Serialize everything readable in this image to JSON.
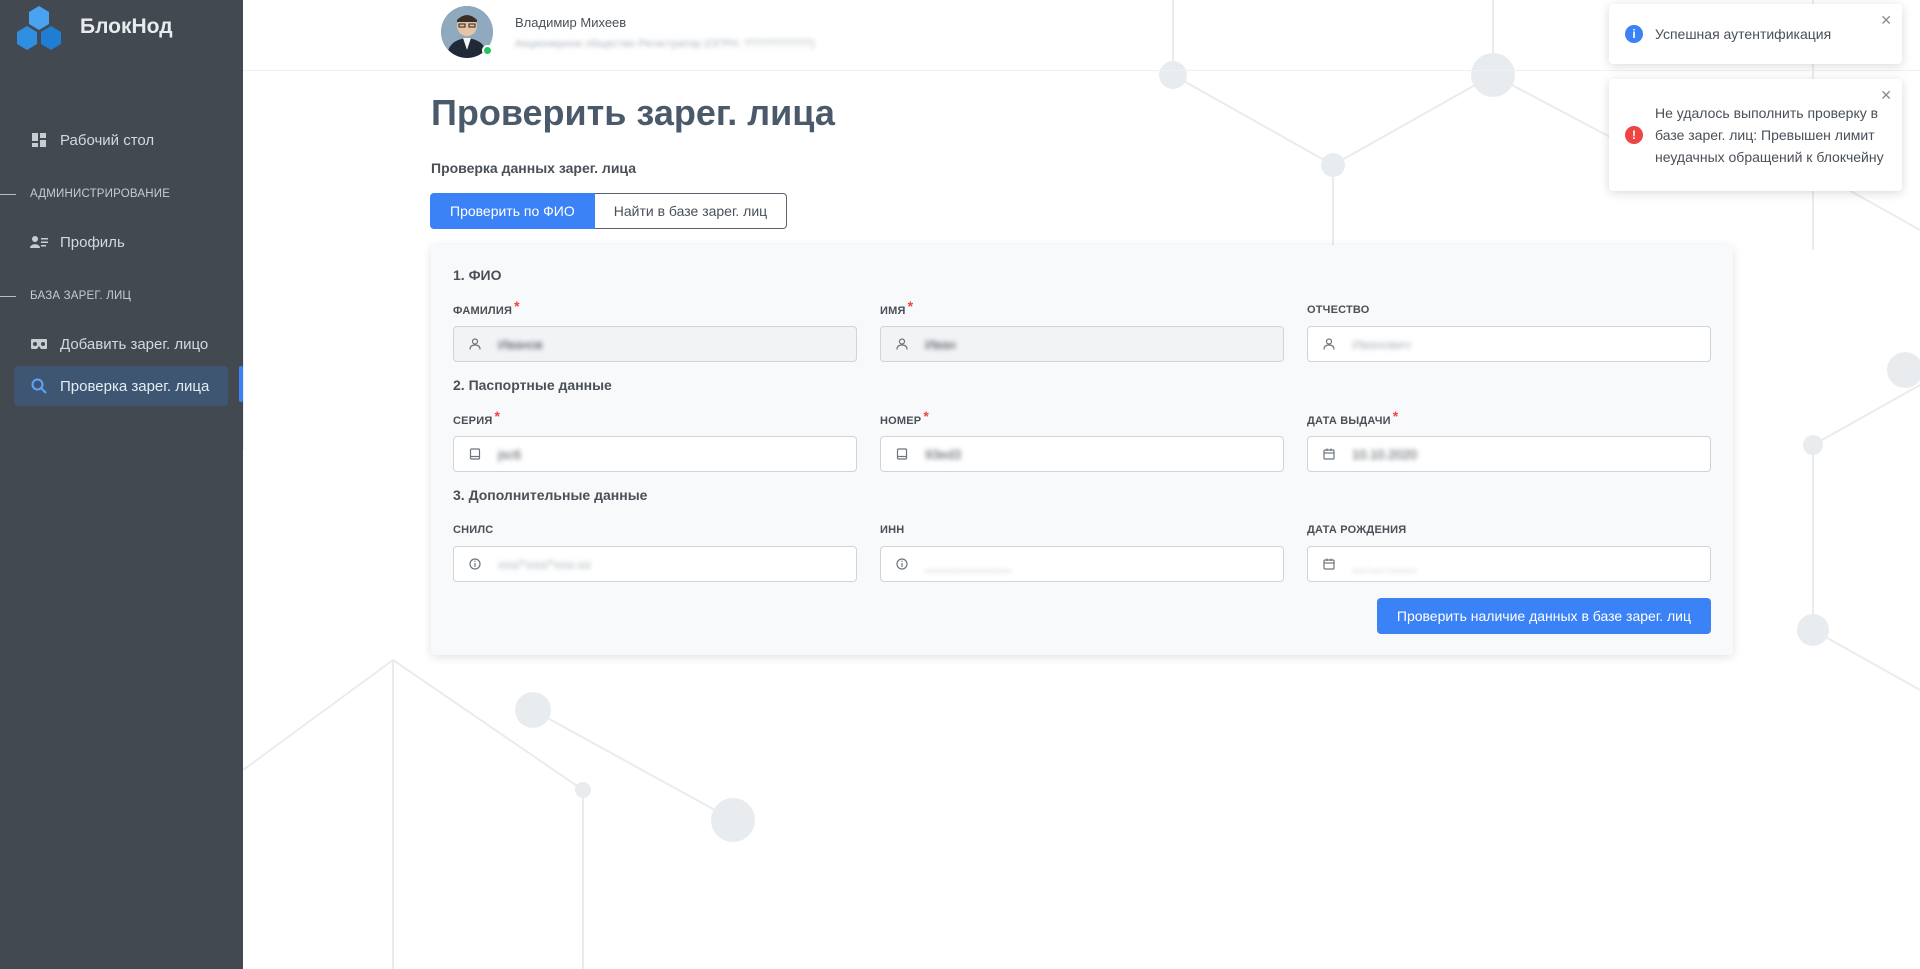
{
  "brand": {
    "name": "БлокНод",
    "logo_icon": "hexagons-logo-icon",
    "color": "#2f8ee0"
  },
  "user": {
    "name": "Владимир Михеев",
    "org": "Акционерное общество Регистратор (ОГРН: ???????????)"
  },
  "sidebar": {
    "items": [
      {
        "label": "Рабочий стол",
        "icon": "dashboard-icon"
      },
      {
        "label": "Профиль",
        "icon": "profile-card-icon"
      },
      {
        "label": "Добавить зарег. лицо",
        "icon": "vr-glasses-icon"
      },
      {
        "label": "Проверка зарег. лица",
        "icon": "search-icon",
        "active": true
      }
    ],
    "sections": [
      "АДМИНИСТРИРОВАНИЕ",
      "БАЗА ЗАРЕГ. ЛИЦ"
    ]
  },
  "page": {
    "title": "Проверить зарег. лица",
    "subtitle": "Проверка данных зарег. лица"
  },
  "tabs": [
    {
      "label": "Проверить по ФИО",
      "active": true
    },
    {
      "label": "Найти в базе зарег. лиц",
      "active": false
    }
  ],
  "form": {
    "sections": [
      "1. ФИО",
      "2. Паспортные данные",
      "3. Дополнительные данные"
    ],
    "fields": {
      "surname": {
        "label": "ФАМИЛИЯ",
        "required": true,
        "value": "Иванов",
        "placeholder": "",
        "icon": "user-icon"
      },
      "name": {
        "label": "ИМЯ",
        "required": true,
        "value": "Иван",
        "placeholder": "",
        "icon": "user-icon"
      },
      "patronymic": {
        "label": "ОТЧЕСТВО",
        "required": false,
        "value": "",
        "placeholder": "Иванович",
        "icon": "user-icon"
      },
      "series": {
        "label": "СЕРИЯ",
        "required": true,
        "value": "jsc6",
        "placeholder": "",
        "icon": "book-icon"
      },
      "number": {
        "label": "НОМЕР",
        "required": true,
        "value": "93ed3",
        "placeholder": "",
        "icon": "book-icon"
      },
      "issue_date": {
        "label": "ДАТА ВЫДАЧИ",
        "required": true,
        "value": "10.10.2020",
        "placeholder": "",
        "icon": "calendar-icon"
      },
      "snils": {
        "label": "СНИЛС",
        "required": false,
        "value": "",
        "placeholder": "xxx/*xxx/*xxx-xx",
        "icon": "info-icon"
      },
      "inn": {
        "label": "ИНН",
        "required": false,
        "value": "",
        "placeholder": "____________",
        "icon": "info-icon"
      },
      "birth_date": {
        "label": "ДАТА РОЖДЕНИЯ",
        "required": false,
        "value": "",
        "placeholder": "__.__.____",
        "icon": "calendar-icon"
      }
    },
    "submit_label": "Проверить наличие данных в базе зарег. лиц"
  },
  "toasts": [
    {
      "type": "info",
      "icon": "info-circle-icon",
      "color": "#3b82f6",
      "text": "Успешная аутентификация"
    },
    {
      "type": "error",
      "icon": "exclamation-circle-icon",
      "color": "#ef4444",
      "text": "Не удалось выполнить проверку в базе зарег. лиц: Превышен лимит неудачных обращений к блокчейну"
    }
  ],
  "colors": {
    "sidebar_bg": "#424950",
    "accent": "#3b82f6",
    "active_nav_bg": "#3f5673"
  }
}
